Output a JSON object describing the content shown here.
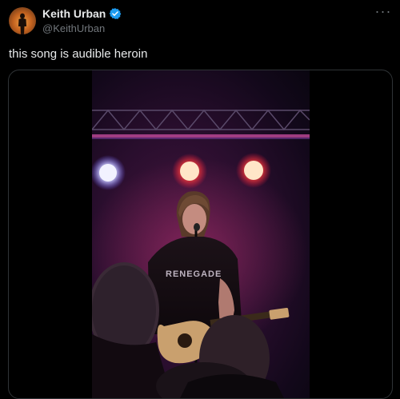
{
  "tweet": {
    "display_name": "Keith Urban",
    "handle": "@KeithUrban",
    "verified": true,
    "text": "this song is audible heroin",
    "more_icon": "more-horizontal-icon"
  },
  "colors": {
    "background": "#000000",
    "text": "#e7e9ea",
    "secondary_text": "#71767b",
    "verified_badge": "#1d9bf0",
    "card_border": "#2f3336"
  },
  "media": {
    "type": "video",
    "shirt_text": "RENEGADE"
  }
}
